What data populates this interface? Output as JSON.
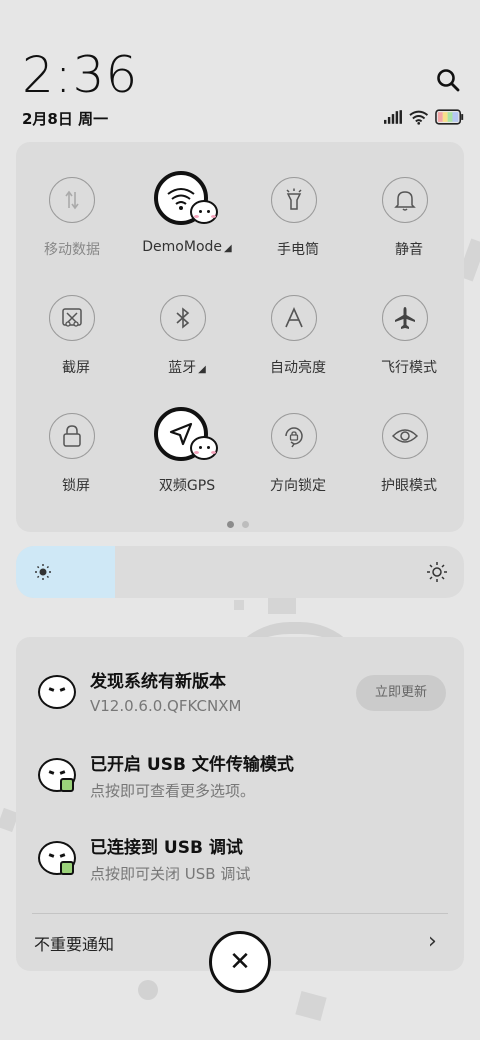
{
  "status": {
    "time": "2:36",
    "date": "2月8日 周一"
  },
  "control_center": {
    "tiles": [
      {
        "label": "移动数据",
        "icon": "mobile-data-icon",
        "active": false,
        "dim": true
      },
      {
        "label": "DemoMode",
        "icon": "wifi-icon",
        "active": true,
        "dropdown": true
      },
      {
        "label": "手电筒",
        "icon": "flashlight-icon",
        "active": false
      },
      {
        "label": "静音",
        "icon": "bell-icon",
        "active": false
      },
      {
        "label": "截屏",
        "icon": "screenshot-icon",
        "active": false
      },
      {
        "label": "蓝牙",
        "icon": "bluetooth-icon",
        "active": false,
        "dropdown": true
      },
      {
        "label": "自动亮度",
        "icon": "auto-brightness-icon",
        "active": false
      },
      {
        "label": "飞行模式",
        "icon": "airplane-icon",
        "active": false
      },
      {
        "label": "锁屏",
        "icon": "lock-icon",
        "active": false
      },
      {
        "label": "双频GPS",
        "icon": "gps-icon",
        "active": true
      },
      {
        "label": "方向锁定",
        "icon": "rotation-lock-icon",
        "active": false
      },
      {
        "label": "护眼模式",
        "icon": "eye-icon",
        "active": false
      }
    ],
    "page_indicator": {
      "current": 1,
      "total": 2
    }
  },
  "brightness": {
    "level": 0.22
  },
  "notifications": [
    {
      "title": "发现系统有新版本",
      "subtitle": "V12.0.6.0.QFKCNXM",
      "action": "立即更新"
    },
    {
      "title": "已开启 USB 文件传输模式",
      "subtitle": "点按即可查看更多选项。"
    },
    {
      "title": "已连接到 USB 调试",
      "subtitle": "点按即可关闭 USB 调试"
    }
  ],
  "unimportant_label": "不重要通知",
  "colors": {
    "brightness_fill": "#cfe8f6",
    "panel": "#dcdcdc",
    "background": "#e6e6e6"
  }
}
